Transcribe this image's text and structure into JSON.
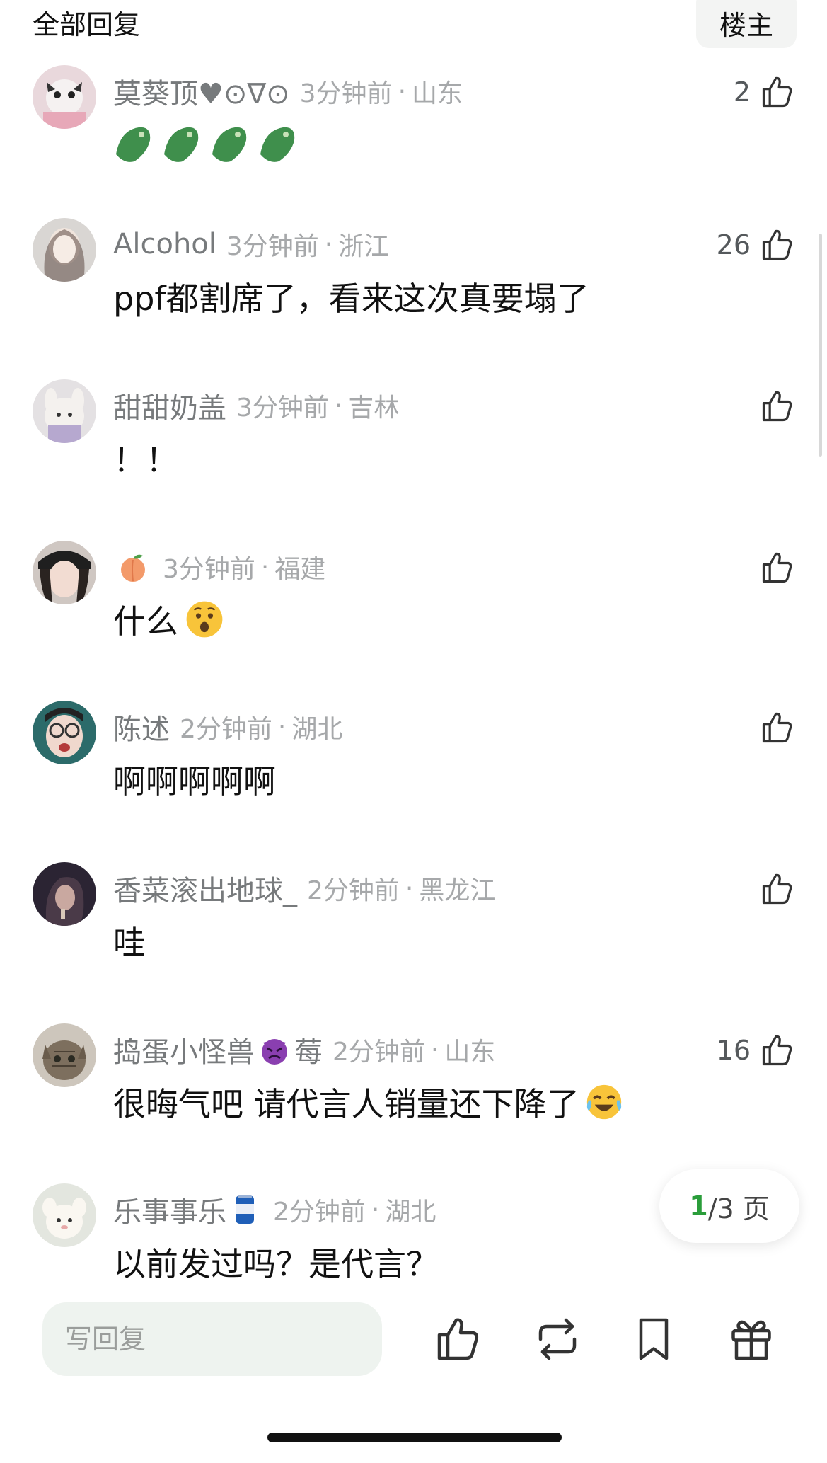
{
  "header": {
    "title": "全部回复",
    "op_label": "楼主"
  },
  "comments": [
    {
      "username": "莫葵顶♥⊙∇⊙",
      "time": "3分钟前",
      "region": "山东",
      "text": "",
      "likes": "2"
    },
    {
      "username": "Alcohol",
      "time": "3分钟前",
      "region": "浙江",
      "text": "ppf都割席了，看来这次真要塌了",
      "likes": "26"
    },
    {
      "username": "甜甜奶盖",
      "time": "3分钟前",
      "region": "吉林",
      "text": "！！",
      "likes": ""
    },
    {
      "username": "",
      "time": "3分钟前",
      "region": "福建",
      "text": "什么",
      "likes": ""
    },
    {
      "username": "陈述",
      "time": "2分钟前",
      "region": "湖北",
      "text": "啊啊啊啊啊",
      "likes": ""
    },
    {
      "username": "香菜滚出地球_",
      "time": "2分钟前",
      "region": "黑龙江",
      "text": "哇",
      "likes": ""
    },
    {
      "username": "捣蛋小怪兽",
      "username_suffix": "莓",
      "time": "2分钟前",
      "region": "山东",
      "text": "很晦气吧 请代言人销量还下降了",
      "likes": "16"
    },
    {
      "username": "乐事事乐",
      "time": "2分钟前",
      "region": "湖北",
      "text": "以前发过吗？是代言？",
      "likes": ""
    }
  ],
  "separator": "·",
  "pagination": {
    "current": "1",
    "rest": "/3 页"
  },
  "bottom_bar": {
    "reply_placeholder": "写回复"
  },
  "icons": {
    "like": "thumbs-up-icon",
    "repost": "repost-icon",
    "bookmark": "bookmark-icon",
    "gift": "gift-icon"
  },
  "colors": {
    "accent_green": "#2a9d3a",
    "meta_gray": "#a6a8aa",
    "input_bg": "#eef3ef"
  }
}
